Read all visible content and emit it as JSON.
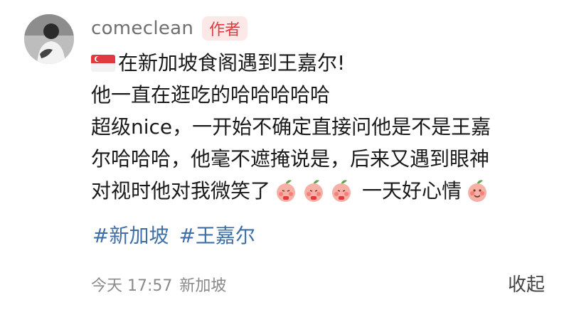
{
  "post": {
    "username": "comeclean",
    "author_badge": "作者",
    "lines": [
      "在新加坡食阁遇到王嘉尔!",
      "他一直在逛吃的哈哈哈哈哈",
      "超级nice，一开始不确定直接问他是不是王嘉",
      "尔哈哈哈，他毫不遮掩说是，后来又遇到眼神",
      "对视时他对我微笑了",
      "一天好心情"
    ],
    "emoji_icons": [
      "singapore-flag-icon",
      "peach-emoji-icon"
    ],
    "hashtags": [
      "#新加坡",
      "#王嘉尔"
    ],
    "time": "今天 17:57",
    "location": "新加坡",
    "collapse_label": "收起"
  },
  "colors": {
    "badge_bg": "#fde8e8",
    "badge_text": "#e0393e",
    "hashtag": "#3f6fa7",
    "meta": "#8a8a8a"
  }
}
